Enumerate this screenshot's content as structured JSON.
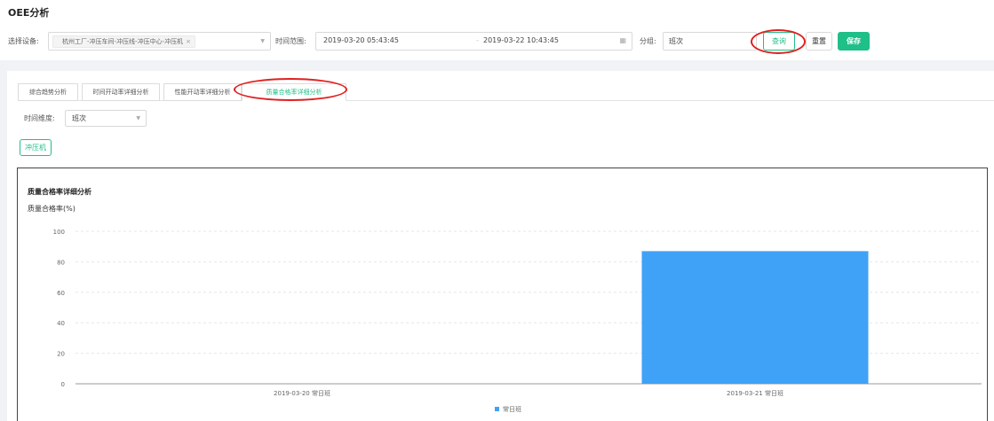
{
  "page_title": "OEE分析",
  "filters": {
    "device_label": "选择设备:",
    "device_tag": "杭州工厂-冲压车间-冲压线-冲压中心-冲压机",
    "time_label": "时间范围:",
    "start_time": "2019-03-20 05:43:45",
    "end_time": "2019-03-22 10:43:45",
    "group_label": "分组:",
    "group_value": "班次"
  },
  "buttons": {
    "query": "查询",
    "reset": "重置",
    "save": "保存"
  },
  "tabs": [
    {
      "label": "综合趋势分析"
    },
    {
      "label": "时间开动率详细分析"
    },
    {
      "label": "性能开动率详细分析"
    },
    {
      "label": "质量合格率详细分析"
    }
  ],
  "active_tab": 3,
  "dimension": {
    "label": "时间维度:",
    "value": "班次"
  },
  "machine_tag": "冲压机",
  "colors": {
    "accent": "#1fbf88",
    "bar": "#3fa2f7",
    "highlight": "#e02020"
  },
  "chart_data": {
    "type": "bar",
    "title": "质量合格率详细分析",
    "ylabel": "质量合格率(%)",
    "xlabel": "",
    "categories": [
      "2019-03-20 常日班",
      "2019-03-21 常日班"
    ],
    "series": [
      {
        "name": "常日班",
        "values": [
          0,
          87
        ]
      }
    ],
    "ylim": [
      0,
      100
    ],
    "yticks": [
      0,
      20,
      40,
      60,
      80,
      100
    ],
    "grid": true,
    "legend": "bottom-center"
  }
}
